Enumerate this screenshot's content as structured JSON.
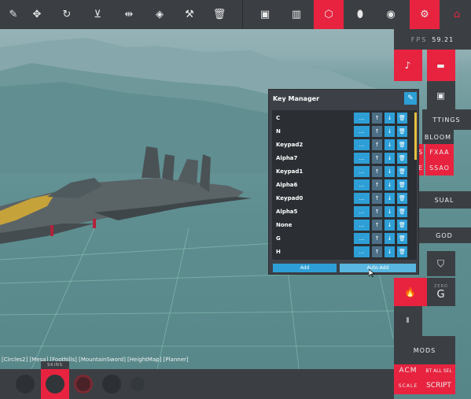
{
  "toolbar": {
    "icons": [
      "paint-icon",
      "move-icon",
      "rotate-icon",
      "scale-icon",
      "flip-icon",
      "eraser-icon",
      "wrench-icon",
      "trash-icon",
      "blueprint-icon",
      "stats-icon",
      "cube-icon",
      "mouse-icon",
      "camera-icon",
      "gear-icon",
      "home-icon"
    ]
  },
  "right_panel": {
    "fps_label": "FPS",
    "fps_value": "59.21",
    "settings_label": "TTINGS",
    "bloom_label": "BLOOM",
    "fxaa_label": "FXAA",
    "ssao_label": "SSAO",
    "s_label": "S",
    "e_label": "E",
    "visual_label": "SUAL",
    "godmode_label": "GOD",
    "zero_label": "ZERO",
    "g_label": "G",
    "mods_label": "MODS",
    "acm_label": "ACM",
    "bt_all_label": "BT ALL SEL",
    "scale_label": "SCALE",
    "script_label": "SCRIPT"
  },
  "key_manager": {
    "title": "Key Manager",
    "rows": [
      {
        "key": "C"
      },
      {
        "key": "N"
      },
      {
        "key": "Keypad2"
      },
      {
        "key": "Alpha7"
      },
      {
        "key": "Keypad1"
      },
      {
        "key": "Alpha6"
      },
      {
        "key": "Keypad0"
      },
      {
        "key": "Alpha5"
      },
      {
        "key": "None"
      },
      {
        "key": "G"
      },
      {
        "key": "H"
      }
    ],
    "row_buttons": {
      "more": "...",
      "up": "↑",
      "down": "↓"
    },
    "add_label": "Add",
    "auto_add_label": "Auto-Add"
  },
  "breadcrumb": "[Circles2]  [Mesa]  [Foothills]  [MountainSword]  [HeightMap]  [Planner]",
  "bottom": {
    "skins_label": "SKINS"
  },
  "colors": {
    "accent_red": "#e7233f",
    "accent_blue": "#2e9fd6",
    "panel_dark": "#3b3f44"
  }
}
